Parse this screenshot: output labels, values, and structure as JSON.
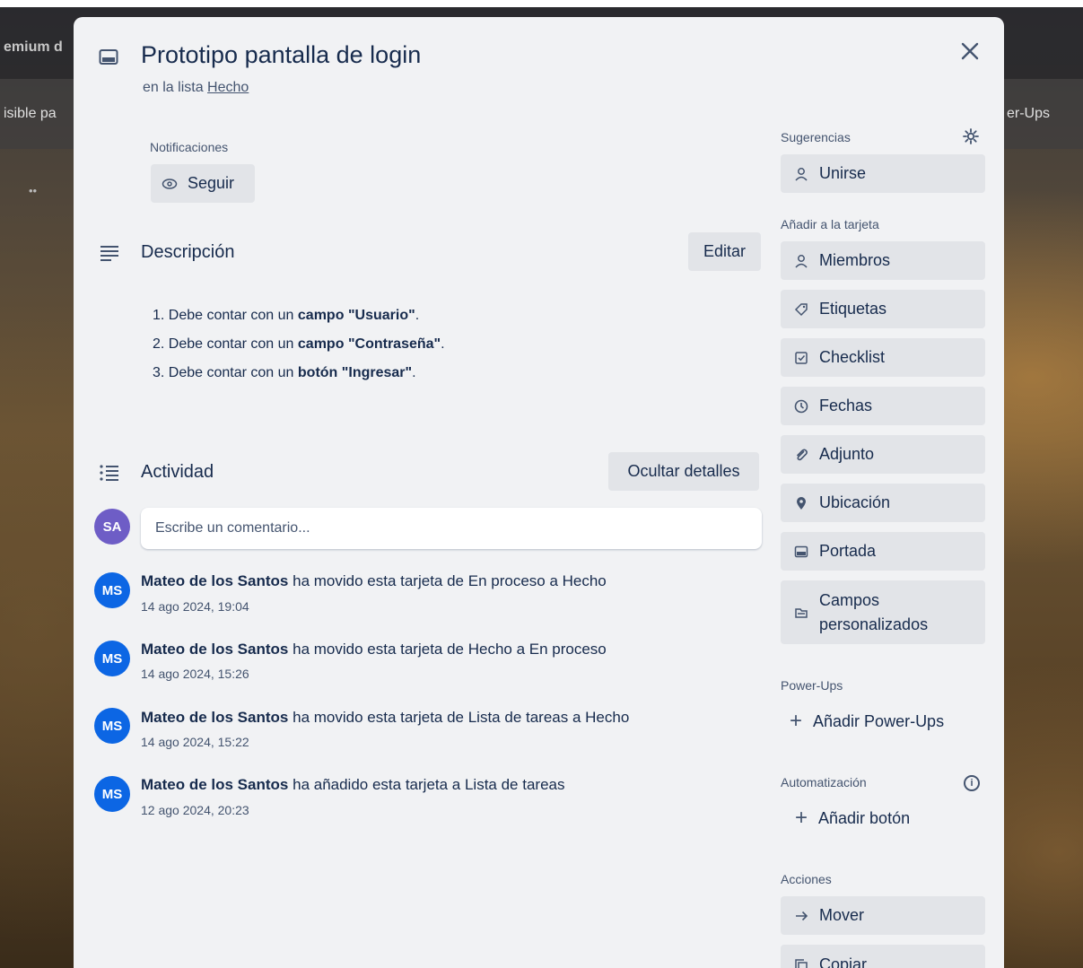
{
  "background": {
    "topbar_text": "emium d",
    "header_left_text": "isible pa",
    "header_right_text": "er-Ups",
    "misc_text": "••"
  },
  "card": {
    "title": "Prototipo pantalla de login",
    "list_prefix": "en la lista",
    "list_name": "Hecho"
  },
  "notifications": {
    "label": "Notificaciones",
    "follow_button": "Seguir"
  },
  "description": {
    "title": "Descripción",
    "edit_button": "Editar",
    "items": [
      {
        "num": "1.",
        "pre": "Debe contar con un",
        "bold1": "campo",
        "bold2": "\"Usuario\"",
        "post": "."
      },
      {
        "num": "2.",
        "pre": "Debe contar con un",
        "bold1": "campo",
        "bold2": "\"Contraseña\"",
        "post": "."
      },
      {
        "num": "3.",
        "pre": "Debe contar con un",
        "bold1": "botón",
        "bold2": "\"Ingresar\"",
        "post": "."
      }
    ]
  },
  "activity": {
    "title": "Actividad",
    "hide_details_button": "Ocultar detalles",
    "current_user_initials": "SA",
    "comment_placeholder": "Escribe un comentario...",
    "entries": [
      {
        "initials": "MS",
        "user": "Mateo de los Santos",
        "action": "ha movido esta tarjeta de En proceso a Hecho",
        "time": "14 ago 2024, 19:04"
      },
      {
        "initials": "MS",
        "user": "Mateo de los Santos",
        "action": "ha movido esta tarjeta de Hecho a En proceso",
        "time": "14 ago 2024, 15:26"
      },
      {
        "initials": "MS",
        "user": "Mateo de los Santos",
        "action": "ha movido esta tarjeta de Lista de tareas a Hecho",
        "time": "14 ago 2024, 15:22"
      },
      {
        "initials": "MS",
        "user": "Mateo de los Santos",
        "action": "ha añadido esta tarjeta a Lista de tareas",
        "time": "12 ago 2024, 20:23"
      }
    ]
  },
  "sidebar": {
    "suggestions_label": "Sugerencias",
    "join_button": "Unirse",
    "add_to_card_label": "Añadir a la tarjeta",
    "add_items": [
      {
        "label": "Miembros",
        "icon": "person-icon"
      },
      {
        "label": "Etiquetas",
        "icon": "tag-icon"
      },
      {
        "label": "Checklist",
        "icon": "checklist-icon"
      },
      {
        "label": "Fechas",
        "icon": "clock-icon"
      },
      {
        "label": "Adjunto",
        "icon": "paperclip-icon"
      },
      {
        "label": "Ubicación",
        "icon": "location-pin-icon"
      },
      {
        "label": "Portada",
        "icon": "cover-icon"
      }
    ],
    "custom_fields_line1": "Campos",
    "custom_fields_line2": "personalizados",
    "powerups_label": "Power-Ups",
    "add_powerups_button": "Añadir Power-Ups",
    "automation_label": "Automatización",
    "add_button_button": "Añadir botón",
    "actions_label": "Acciones",
    "move_button": "Mover",
    "copy_button": "Copiar"
  },
  "colors": {
    "modal_bg": "#f1f2f4",
    "button_bg": "#e2e4e8",
    "avatar_ms": "#0c66e4",
    "avatar_sa": "#6e5dc6",
    "text_primary": "#172b4d",
    "text_subtle": "#44546f"
  }
}
